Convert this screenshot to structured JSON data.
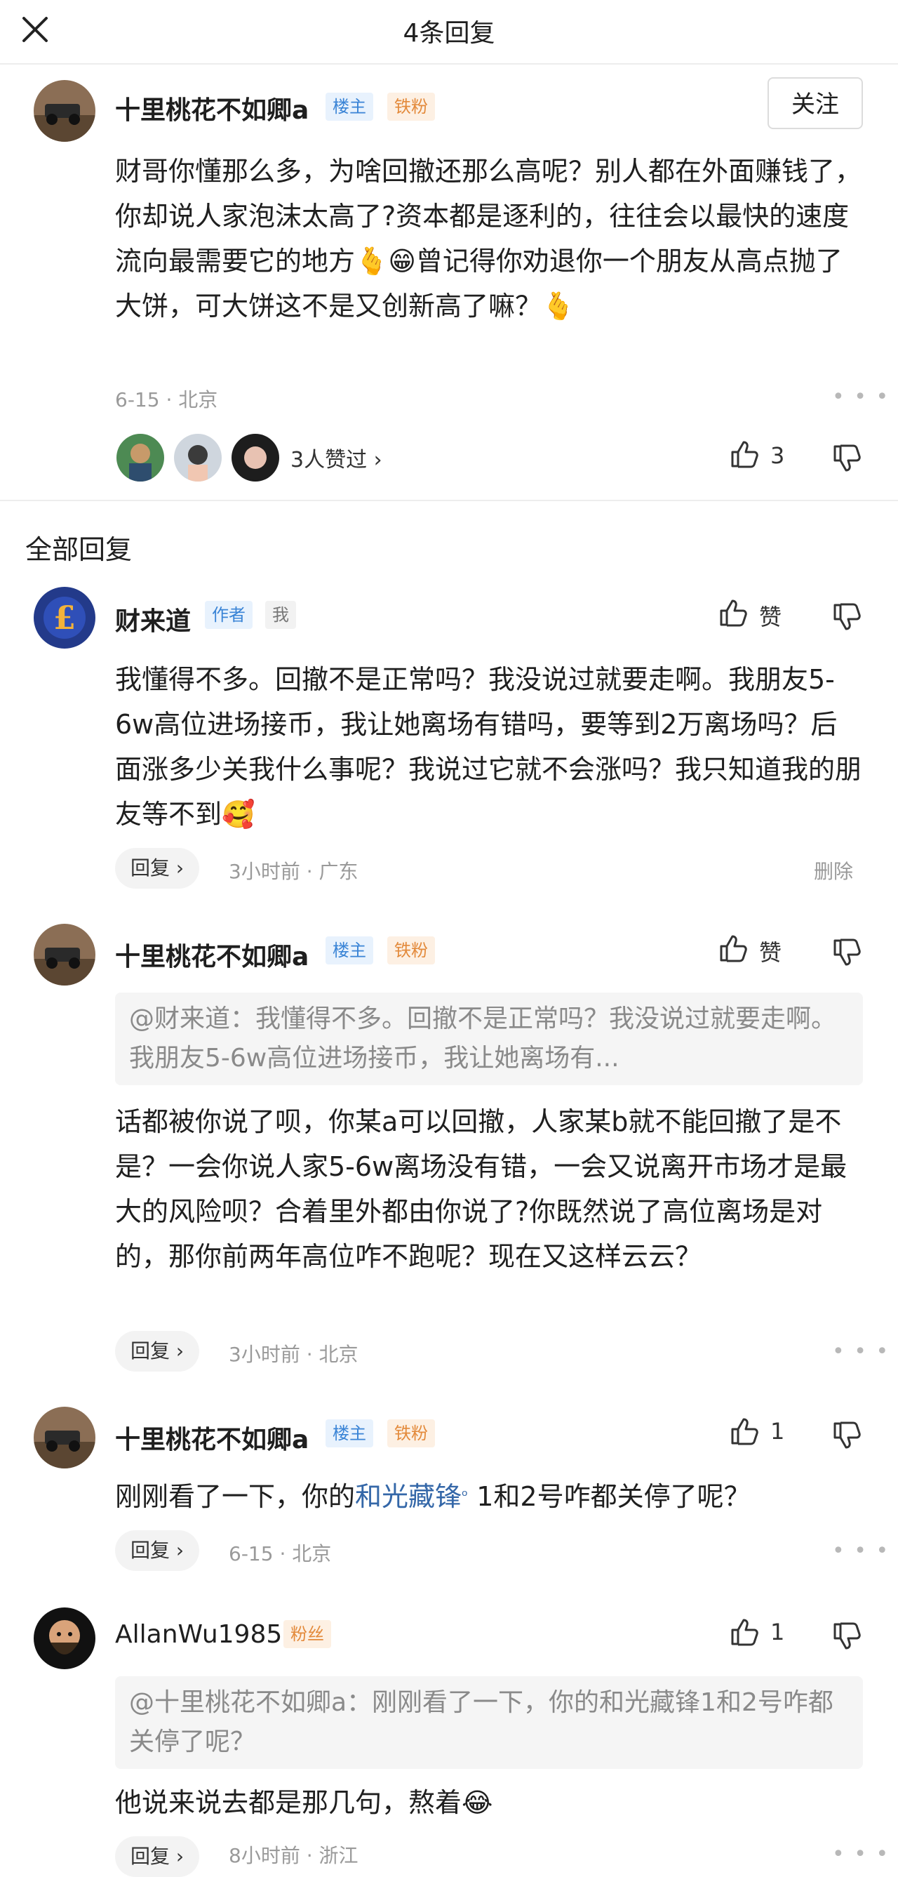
{
  "header": {
    "title": "4条回复"
  },
  "main_comment": {
    "username": "十里桃花不如卿a",
    "tag_owner": "楼主",
    "tag_fan": "铁粉",
    "follow_label": "关注",
    "text": "财哥你懂那么多，为啥回撤还那么高呢？别人都在外面赚钱了，你却说人家泡沫太高了?资本都是逐利的，往往会以最快的速度流向最需要它的地方🫰😁曾记得你劝退你一个朋友从高点抛了大饼，可大饼这不是又创新高了嘛？🫰",
    "meta": "6-15 · 北京",
    "likers_text": "3人赞过 ›",
    "like_count": "3"
  },
  "section_title": "全部回复",
  "replies": [
    {
      "username": "财来道",
      "tag1": "作者",
      "tag2": "我",
      "like_label": "赞",
      "text": "我懂得不多。回撤不是正常吗？我没说过就要走啊。我朋友5-6w高位进场接币，我让她离场有错吗，要等到2万离场吗？后面涨多少关我什么事呢？我说过它就不会涨吗？我只知道我的朋友等不到🥰",
      "reply_label": "回复 ›",
      "meta": "3小时前 · 广东",
      "delete_label": "删除"
    },
    {
      "username": "十里桃花不如卿a",
      "tag1": "楼主",
      "tag2": "铁粉",
      "like_label": "赞",
      "quote": "@财来道：我懂得不多。回撤不是正常吗？我没说过就要走啊。我朋友5-6w高位进场接币，我让她离场有...",
      "text": "话都被你说了呗，你某a可以回撤，人家某b就不能回撤了是不是？一会你说人家5-6w离场没有错，一会又说离开市场才是最大的风险呗？合着里外都由你说了?你既然说了高位离场是对的，那你前两年高位咋不跑呢？现在又这样云云？",
      "reply_label": "回复 ›",
      "meta": "3小时前 · 北京"
    },
    {
      "username": "十里桃花不如卿a",
      "tag1": "楼主",
      "tag2": "铁粉",
      "like_count": "1",
      "text_before": "刚刚看了一下，你的",
      "text_link": "和光藏锋",
      "text_after": " 1和2号咋都关停了呢？",
      "reply_label": "回复 ›",
      "meta": "6-15 · 北京"
    },
    {
      "username": "AllanWu1985",
      "tag1": "粉丝",
      "like_count": "1",
      "quote": "@十里桃花不如卿a：刚刚看了一下，你的和光藏锋1和2号咋都关停了呢？",
      "text": "他说来说去都是那几句，熬着😂",
      "reply_label": "回复 ›",
      "meta": "8小时前 · 浙江"
    }
  ],
  "icons": {
    "close": "close-icon",
    "thumbs_up": "thumbs-up-icon",
    "thumbs_down": "thumbs-down-icon",
    "more": "more-dots-icon"
  },
  "colors": {
    "tag_owner_text": "#3a84d6",
    "tag_fan_text": "#e38a3b",
    "link": "#3467a8",
    "meta": "#9a9a9a"
  }
}
